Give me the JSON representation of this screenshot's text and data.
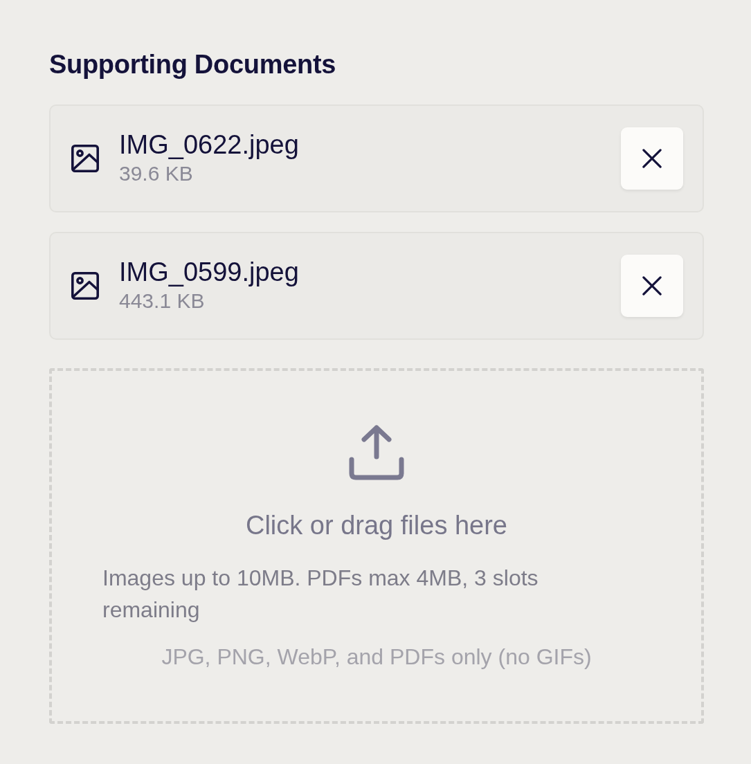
{
  "section_title": "Supporting Documents",
  "files": [
    {
      "name": "IMG_0622.jpeg",
      "size": "39.6 KB"
    },
    {
      "name": "IMG_0599.jpeg",
      "size": "443.1 KB"
    }
  ],
  "dropzone": {
    "prompt": "Click or drag files here",
    "limits": "Images up to 10MB. PDFs max 4MB, 3 slots remaining",
    "formats": "JPG, PNG, WebP, and PDFs only (no GIFs)"
  }
}
